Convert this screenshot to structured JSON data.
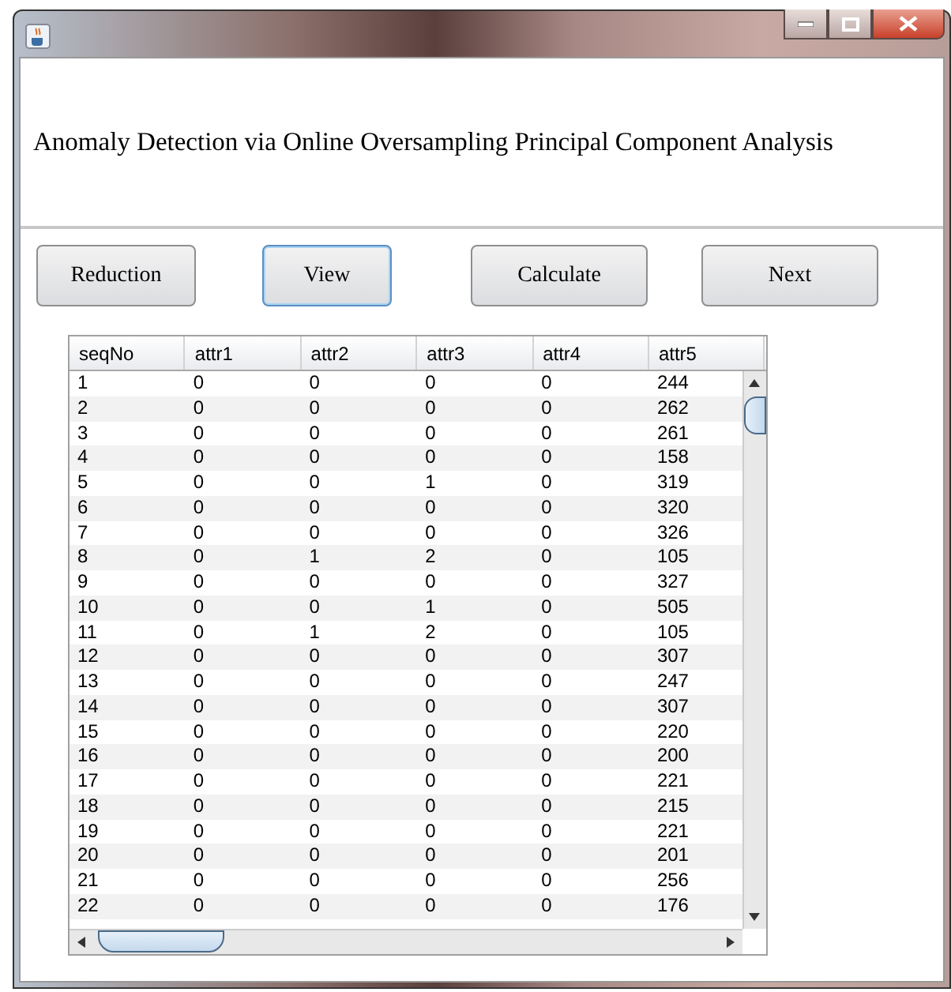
{
  "window": {
    "title_heading": "Anomaly Detection via Online Oversampling Principal Component Analysis"
  },
  "buttons": [
    {
      "label": "Reduction",
      "focused": false
    },
    {
      "label": "View",
      "focused": true
    },
    {
      "label": "Calculate",
      "focused": false
    },
    {
      "label": "Next",
      "focused": false
    }
  ],
  "table": {
    "columns": [
      "seqNo",
      "attr1",
      "attr2",
      "attr3",
      "attr4",
      "attr5"
    ],
    "rows": [
      [
        "1",
        "0",
        "0",
        "0",
        "0",
        "244"
      ],
      [
        "2",
        "0",
        "0",
        "0",
        "0",
        "262"
      ],
      [
        "3",
        "0",
        "0",
        "0",
        "0",
        "261"
      ],
      [
        "4",
        "0",
        "0",
        "0",
        "0",
        "158"
      ],
      [
        "5",
        "0",
        "0",
        "1",
        "0",
        "319"
      ],
      [
        "6",
        "0",
        "0",
        "0",
        "0",
        "320"
      ],
      [
        "7",
        "0",
        "0",
        "0",
        "0",
        "326"
      ],
      [
        "8",
        "0",
        "1",
        "2",
        "0",
        "105"
      ],
      [
        "9",
        "0",
        "0",
        "0",
        "0",
        "327"
      ],
      [
        "10",
        "0",
        "0",
        "1",
        "0",
        "505"
      ],
      [
        "11",
        "0",
        "1",
        "2",
        "0",
        "105"
      ],
      [
        "12",
        "0",
        "0",
        "0",
        "0",
        "307"
      ],
      [
        "13",
        "0",
        "0",
        "0",
        "0",
        "247"
      ],
      [
        "14",
        "0",
        "0",
        "0",
        "0",
        "307"
      ],
      [
        "15",
        "0",
        "0",
        "0",
        "0",
        "220"
      ],
      [
        "16",
        "0",
        "0",
        "0",
        "0",
        "200"
      ],
      [
        "17",
        "0",
        "0",
        "0",
        "0",
        "221"
      ],
      [
        "18",
        "0",
        "0",
        "0",
        "0",
        "215"
      ],
      [
        "19",
        "0",
        "0",
        "0",
        "0",
        "221"
      ],
      [
        "20",
        "0",
        "0",
        "0",
        "0",
        "201"
      ],
      [
        "21",
        "0",
        "0",
        "0",
        "0",
        "256"
      ],
      [
        "22",
        "0",
        "0",
        "0",
        "0",
        "176"
      ]
    ]
  }
}
